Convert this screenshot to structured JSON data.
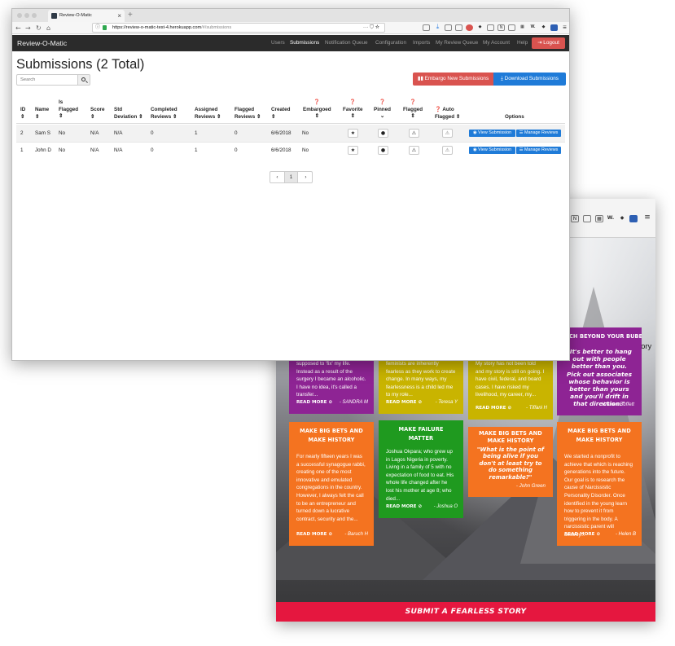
{
  "front": {
    "tab": {
      "title": "Review-O-Matic"
    },
    "address_bar": {
      "host": "https://review-o-matic-test-4.herokuapp.com",
      "path": "/#/submissions",
      "actions": "··· ⛉ ☆"
    },
    "app": {
      "brand": "Review-O-Matic",
      "nav": [
        "Users",
        "Submissions",
        "Notification Queue",
        "Configuration",
        "Imports",
        "My Review Queue",
        "My Account",
        "Help"
      ],
      "active_nav": "Submissions",
      "logout": "Logout"
    },
    "page": {
      "title": "Submissions (2 Total)",
      "search_placeholder": "Search",
      "embargo_button": "Embargo New Submissions",
      "download_button": "Download Submissions"
    },
    "table": {
      "headers": {
        "id": [
          "ID",
          "⇕"
        ],
        "name": [
          "Name",
          "⇕"
        ],
        "flagged": [
          "Is",
          "Flagged",
          "⇕"
        ],
        "score": [
          "Score",
          "⇕"
        ],
        "stddev": [
          "Std",
          "Deviation ⇕"
        ],
        "completed": [
          "Completed",
          "Reviews ⇕"
        ],
        "assigned": [
          "Assigned",
          "Reviews ⇕"
        ],
        "flagged_reviews": [
          "Flagged",
          "Reviews ⇕"
        ],
        "created": [
          "Created",
          "⇕"
        ],
        "embargoed": [
          "❓",
          "Embargoed",
          "⇕"
        ],
        "favorite": [
          "❓",
          "Favorite",
          "⇕"
        ],
        "pinned": [
          "❓",
          "Pinned",
          "⌄"
        ],
        "flagged2": [
          "❓",
          "Flagged",
          "⇕"
        ],
        "auto": [
          "❓ Auto",
          "Flagged ⇕"
        ],
        "options": [
          "Options"
        ]
      },
      "rows": [
        {
          "id": "2",
          "name": "Sam S",
          "is_flagged": "No",
          "score": "N/A",
          "std": "N/A",
          "completed": "0",
          "assigned": "1",
          "flagged_reviews": "0",
          "created": "6/6/2018",
          "embargoed": "No",
          "view": "View Submission",
          "manage": "Manage Reviews"
        },
        {
          "id": "1",
          "name": "John D",
          "is_flagged": "No",
          "score": "N/A",
          "std": "N/A",
          "completed": "0",
          "assigned": "1",
          "flagged_reviews": "0",
          "created": "6/6/2018",
          "embargoed": "No",
          "view": "View Submission",
          "manage": "Manage Reviews"
        }
      ]
    },
    "pager": {
      "prev": "‹",
      "current": "1",
      "next": "›"
    }
  },
  "back": {
    "hero_text": "ckle the world's s story below!",
    "submit_label": "SUBMIT A FEARLESS STORY",
    "cards": [
      {
        "body": "supposed to 'fix' my life. Instead as a result of the surgery I became an alcoholic. I have no idea, it's called a transfer...",
        "readmore": "READ MORE ⊘",
        "author": "- SANDRA M",
        "color": "#8e2494"
      },
      {
        "body": "feminists are inherently fearless as they work to create change. In many ways, my fearlessness is a child led me to my role...",
        "readmore": "READ MORE ⊘",
        "author": "- Teresa Y",
        "color": "#8e2494"
      },
      {
        "body": "My story has not been told and my story is still on going. I have civil, federal, and board cases. I have risked my livelihood, my career, my...",
        "readmore": "READ MORE ⊘",
        "author": "- Tiffani H",
        "color": "#c9b400"
      },
      {
        "title": "REACH BEYOND YOUR BUBBLE",
        "quote": "\"It's better to hang out with people better than you. Pick out associates whose behavior is better than yours and you'll drift in that direction.\"",
        "author": "- Warren Buffett",
        "color": "#8e2494"
      },
      {
        "title": "MAKE BIG BETS AND MAKE HISTORY",
        "body": "For nearly fifteen years I was a successful synagogue rabbi, creating one of the most innovative and emulated congregations in the country. However, I always felt the call to be an entrepreneur and turned down a lucrative contract, security and the...",
        "readmore": "READ MORE ⊘",
        "author": "- Baruch H",
        "color": "#f47320"
      },
      {
        "title": "MAKE FAILURE MATTER",
        "body": "Joshua Okpara; who grew up in Lagos Nigeria in poverty. Living in a family of 5 with no expectation of food to eat. His whole life changed after he lost his mother at age 8; who died...",
        "readmore": "READ MORE ⊘",
        "author": "- Joshua O",
        "color": "#1f9a1f"
      },
      {
        "title": "MAKE BIG BETS AND MAKE HISTORY",
        "quote": "\"What is the point of being alive if you don't at least try to do something remarkable?\"",
        "author": "- John Green",
        "color": "#f47320"
      },
      {
        "title": "MAKE BIG BETS AND MAKE HISTORY",
        "body": "We started a nonprofit to achieve that which is reaching generations into the future. Our goal is to research the cause of Narcissistic Personality Disorder. Once identified in the young learn how to prevent it from triggering in the body. A narcissistic parent will destroy...",
        "readmore": "READ MORE ⊘",
        "author": "- Helen B",
        "color": "#f47320"
      }
    ]
  },
  "colors": {
    "navbar": "#2b2b2b",
    "danger": "#d9534f",
    "primary": "#1f7bd8",
    "submit_bar": "#e5173f"
  }
}
